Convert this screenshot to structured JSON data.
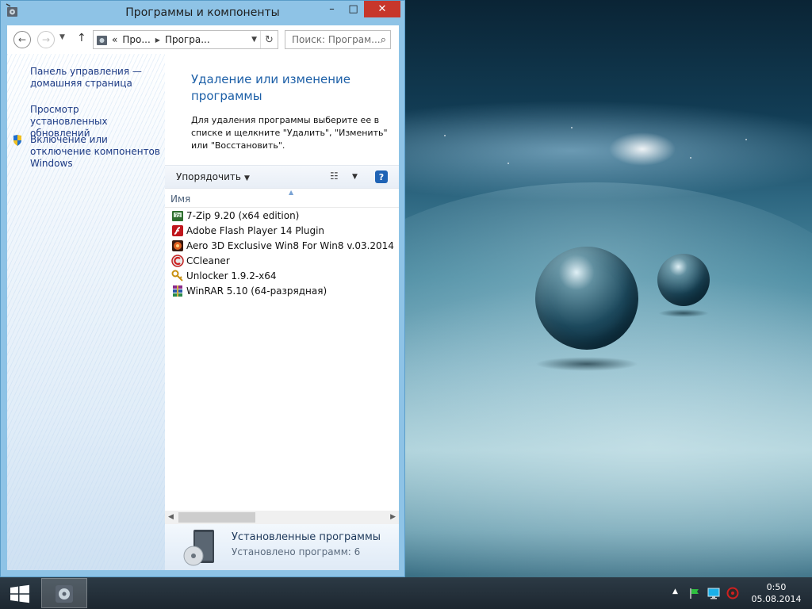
{
  "window": {
    "title": "Программы и компоненты",
    "minimize": "–",
    "maximize": "□",
    "close": "✕"
  },
  "nav": {
    "breadcrumb_prefix": "«",
    "breadcrumbs": [
      "Про...",
      "Програ..."
    ],
    "search_placeholder": "Поиск: Програм..."
  },
  "sidebar": {
    "items": [
      {
        "label": "Панель управления — домашняя страница"
      },
      {
        "label": "Просмотр установленных обновлений"
      },
      {
        "label": "Включение или отключение компонентов Windows"
      }
    ]
  },
  "main": {
    "heading": "Удаление или изменение программы",
    "description": "Для удаления программы выберите ее в списке и щелкните \"Удалить\", \"Изменить\" или \"Восстановить\".",
    "toolbar": {
      "organize": "Упорядочить"
    },
    "column_name": "Имя",
    "programs": [
      {
        "name": "7-Zip 9.20 (x64 edition)",
        "icon": "7zip-icon"
      },
      {
        "name": "Adobe Flash Player 14 Plugin",
        "icon": "flash-icon"
      },
      {
        "name": "Aero 3D Exclusive Win8 For Win8 v.03.2014",
        "icon": "aero-icon"
      },
      {
        "name": "CCleaner",
        "icon": "ccleaner-icon"
      },
      {
        "name": "Unlocker 1.9.2-x64",
        "icon": "unlocker-icon"
      },
      {
        "name": "WinRAR 5.10 (64-разрядная)",
        "icon": "winrar-icon"
      }
    ]
  },
  "details": {
    "title": "Установленные программы",
    "count": "Установлено программ: 6"
  },
  "taskbar": {
    "time": "0:50",
    "date": "05.08.2014"
  },
  "colors": {
    "window_frame": "#8ec3e6",
    "link": "#1c3a84",
    "heading": "#1c5fa7",
    "close": "#c7372b"
  }
}
